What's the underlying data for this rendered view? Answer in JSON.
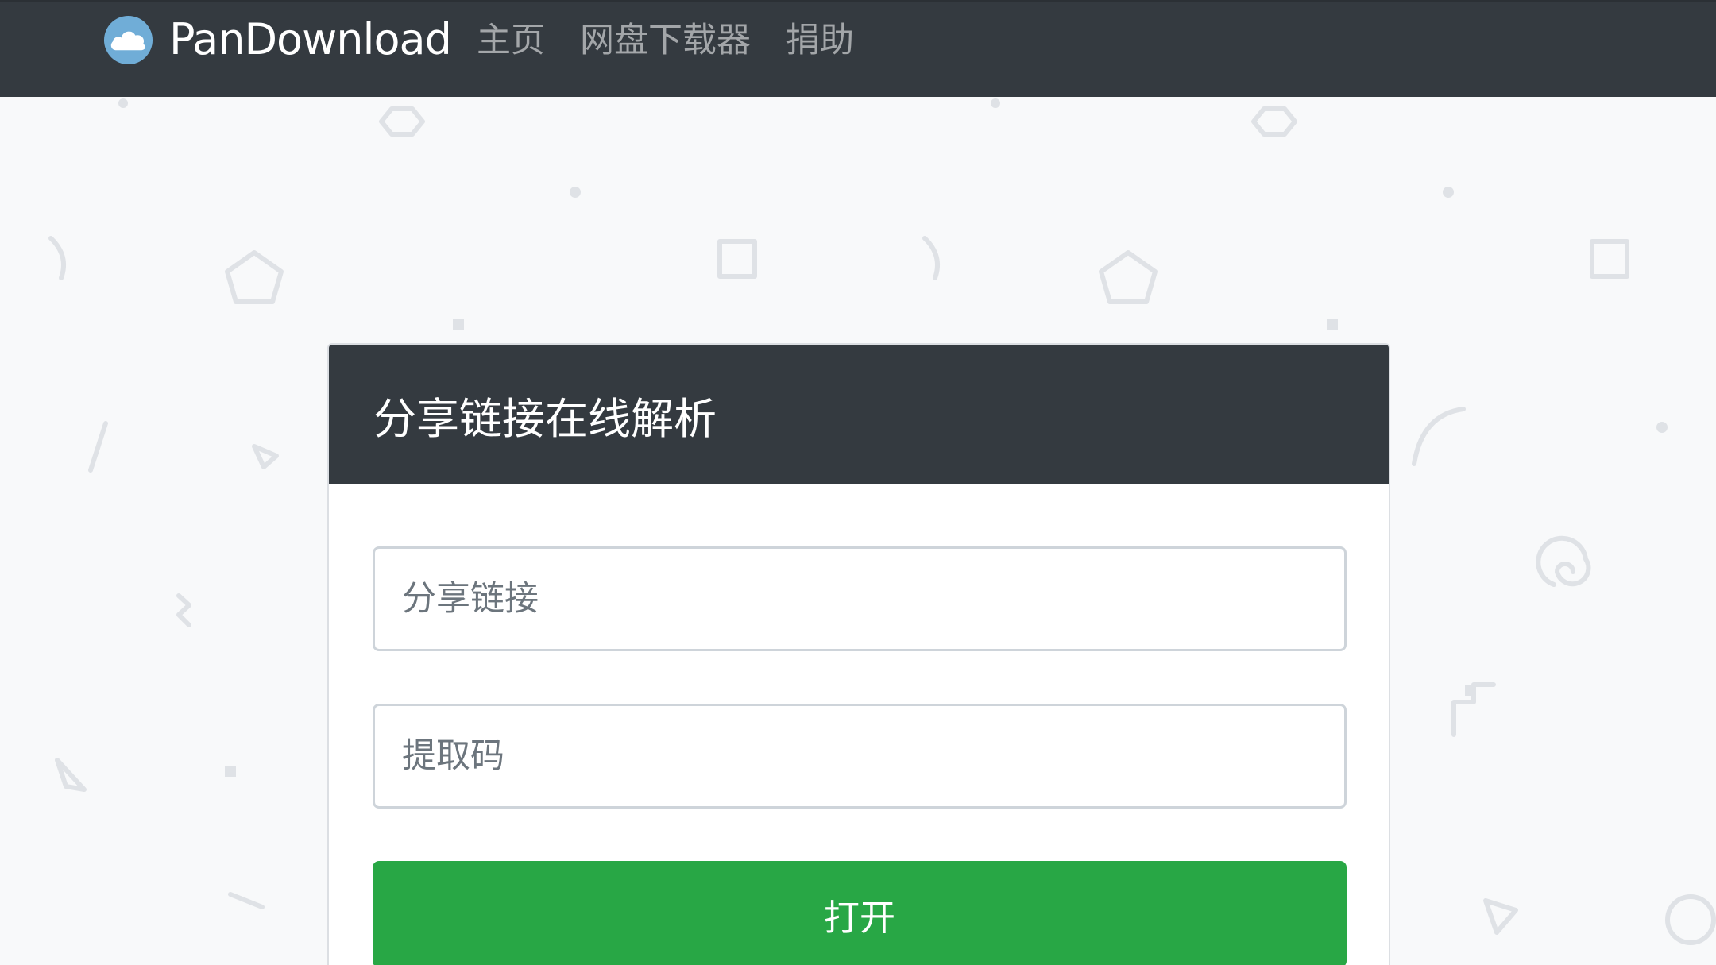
{
  "navbar": {
    "brand_name": "PanDownload",
    "links": [
      "主页",
      "网盘下载器",
      "捐助"
    ]
  },
  "card": {
    "title": "分享链接在线解析",
    "share_link_placeholder": "分享链接",
    "share_link_value": "",
    "extract_code_placeholder": "提取码",
    "extract_code_value": "",
    "open_button_label": "打开"
  },
  "icons": {
    "brand_logo": "cloud-icon"
  },
  "colors": {
    "navbar": "#343a40",
    "page_background": "#f8f9fa",
    "primary_button": "#28a745",
    "card_header": "#343a40"
  }
}
